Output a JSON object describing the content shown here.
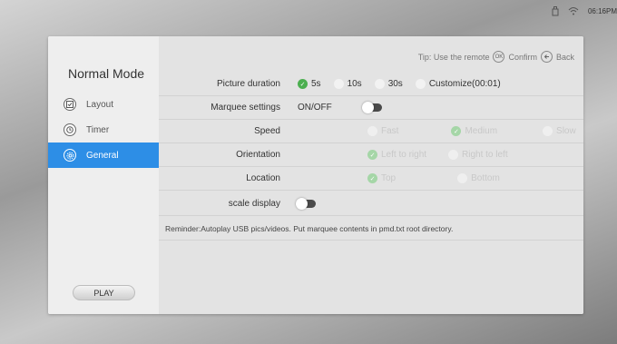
{
  "statusbar": {
    "time": "06:16PM",
    "icons": [
      "usb-icon",
      "wifi-icon"
    ]
  },
  "sidebar": {
    "title": "Normal Mode",
    "items": [
      {
        "label": "Layout",
        "icon": "layout-icon",
        "active": false
      },
      {
        "label": "Timer",
        "icon": "timer-icon",
        "active": false
      },
      {
        "label": "General",
        "icon": "gear-icon",
        "active": true
      }
    ],
    "play_label": "PLAY"
  },
  "tip": {
    "text": "Tip: Use the remote",
    "confirm_glyph": "OK",
    "confirm": "Confirm",
    "back": "Back"
  },
  "settings": {
    "picture_duration": {
      "label": "Picture duration",
      "options": [
        "5s",
        "10s",
        "30s",
        "Customize(00:01)"
      ],
      "selected": "5s"
    },
    "marquee": {
      "label": "Marquee settings",
      "toggle_label": "ON/OFF",
      "enabled": false
    },
    "speed": {
      "label": "Speed",
      "options": [
        "Fast",
        "Medium",
        "Slow"
      ],
      "selected": "Medium"
    },
    "orientation": {
      "label": "Orientation",
      "options": [
        "Left to right",
        "Right to left"
      ],
      "selected": "Left to right"
    },
    "location": {
      "label": "Location",
      "options": [
        "Top",
        "Bottom"
      ],
      "selected": "Top"
    },
    "scale_display": {
      "label": "scale display",
      "enabled": false
    }
  },
  "reminder": "Reminder:Autoplay USB pics/videos.  Put marquee contents in pmd.txt root directory.",
  "colors": {
    "accent": "#2d8ee6",
    "selected": "#4caf50"
  }
}
